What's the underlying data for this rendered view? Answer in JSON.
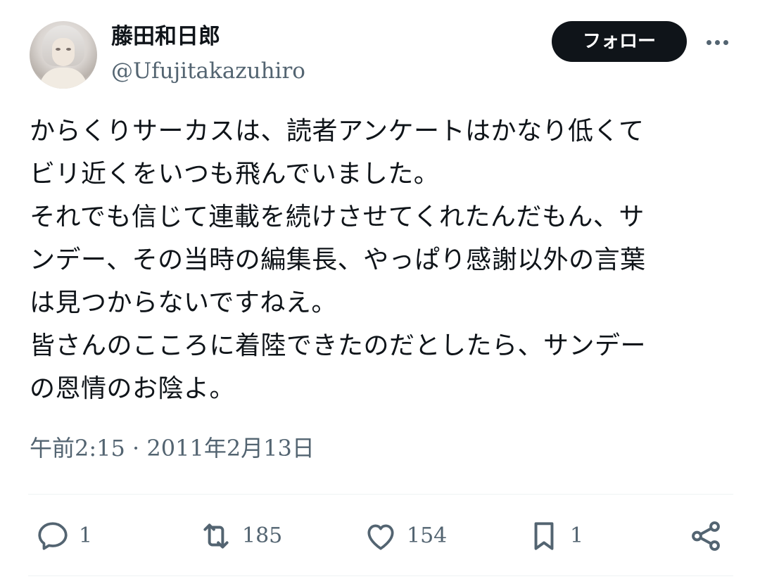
{
  "author": {
    "display_name": "藤田和日郎",
    "handle": "@Ufujitakazuhiro"
  },
  "header": {
    "follow_label": "フォロー",
    "more_icon": "more-horizontal-icon"
  },
  "tweet": {
    "lines": [
      "からくりサーカスは、読者アンケートはかなり低くて",
      "ビリ近くをいつも飛んでいました。",
      "それでも信じて連載を続けさせてくれたんだもん、サ",
      "ンデー、その当時の編集長、やっぱり感謝以外の言葉",
      "は見つからないですねえ。",
      "皆さんのこころに着陸できたのだとしたら、サンデー",
      "の恩情のお陰よ。"
    ],
    "timestamp": "午前2:15 · 2011年2月13日"
  },
  "actions": {
    "reply": {
      "icon": "reply-icon",
      "count": "1"
    },
    "retweet": {
      "icon": "retweet-icon",
      "count": "185"
    },
    "like": {
      "icon": "heart-icon",
      "count": "154"
    },
    "bookmark": {
      "icon": "bookmark-icon",
      "count": "1"
    },
    "share": {
      "icon": "share-icon"
    }
  },
  "colors": {
    "text_primary": "#0f1419",
    "text_secondary": "#536471",
    "follow_bg": "#0f1419",
    "divider": "#eff3f4"
  }
}
